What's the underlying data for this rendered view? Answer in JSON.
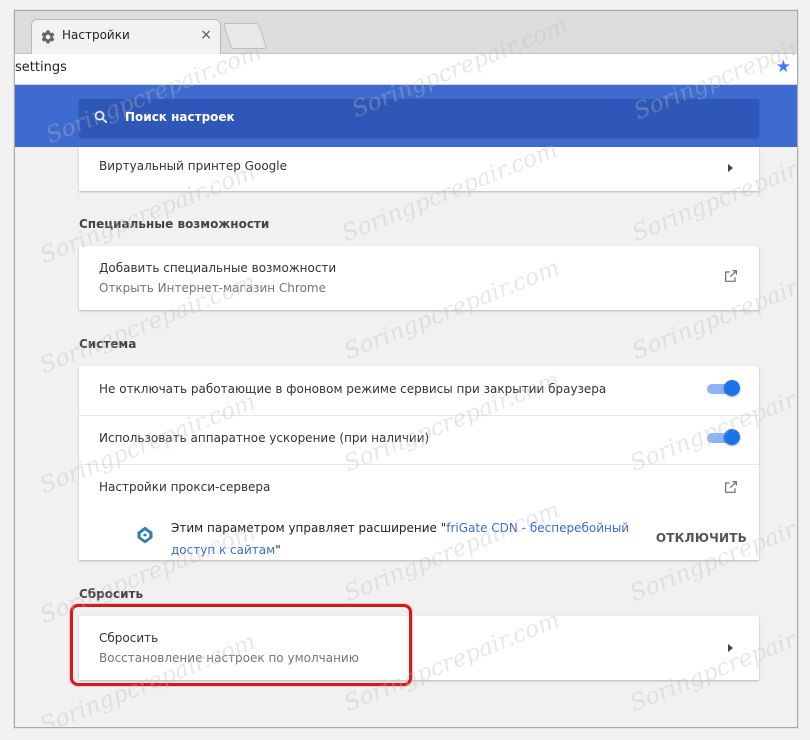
{
  "browser": {
    "tab_title": "Настройки",
    "tab_close": "×",
    "address": "settings"
  },
  "search": {
    "placeholder": "Поиск настроек"
  },
  "sections": {
    "printing": {
      "item_label": "Виртуальный принтер Google"
    },
    "accessibility": {
      "title": "Специальные возможности",
      "item_label": "Добавить специальные возможности",
      "item_sublabel": "Открыть Интернет-магазин Chrome"
    },
    "system": {
      "title": "Система",
      "background_apps": {
        "label": "Не отключать работающие в фоновом режиме сервисы при закрытии браузера",
        "enabled": true
      },
      "hardware_accel": {
        "label": "Использовать аппаратное ускорение (при наличии)",
        "enabled": true
      },
      "proxy": {
        "label": "Настройки прокси-сервера",
        "extension_notice_prefix": "Этим параметром управляет расширение \"",
        "extension_name": "friGate CDN - бесперебойный доступ к сайтам",
        "extension_notice_suffix": "\"",
        "disable_label": "ОТКЛЮЧИТЬ"
      }
    },
    "reset": {
      "title": "Сбросить",
      "item_label": "Сбросить",
      "item_sublabel": "Восстановление настроек по умолчанию"
    }
  },
  "watermark": "Soringpcrepair.com",
  "colors": {
    "header": "#3e6bd0",
    "search": "#2f57b8",
    "toggle_on": "#1a73e8",
    "highlight": "#d71919"
  }
}
